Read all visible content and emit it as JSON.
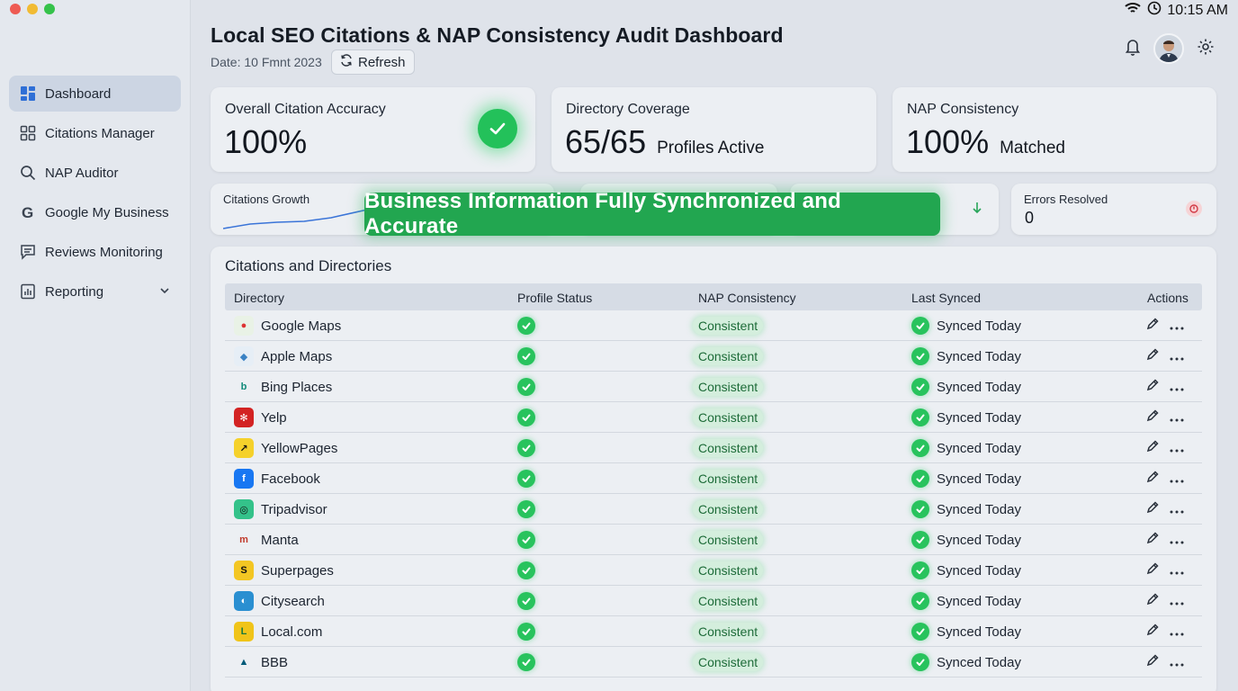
{
  "window": {
    "time": "10:15 AM"
  },
  "sidebar": {
    "items": [
      {
        "label": "Dashboard",
        "icon": "dashboard-icon",
        "active": true
      },
      {
        "label": "Citations Manager",
        "icon": "grid-icon"
      },
      {
        "label": "NAP Auditor",
        "icon": "search-icon"
      },
      {
        "label": "Google My Business",
        "icon": "google-icon"
      },
      {
        "label": "Reviews Monitoring",
        "icon": "chat-icon"
      },
      {
        "label": "Reporting",
        "icon": "report-icon",
        "expandable": true
      }
    ]
  },
  "header": {
    "title": "Local SEO Citations & NAP Consistency Audit Dashboard",
    "date": "Date: 10 Fmnt 2023",
    "refresh_label": "Refresh"
  },
  "kpis": [
    {
      "title": "Overall Citation Accuracy",
      "value": "100%",
      "sub": ""
    },
    {
      "title": "Directory Coverage",
      "value": "65/65",
      "sub": "Profiles Active"
    },
    {
      "title": "NAP Consistency",
      "value": "100%",
      "sub": "Matched"
    }
  ],
  "mini_cards": {
    "growth_title": "Citations Growth",
    "errors_title": "Errors Resolved",
    "errors_value": "0"
  },
  "banner": "Business Information Fully Synchronized and Accurate",
  "table": {
    "title": "Citations and Directories",
    "columns": [
      "Directory",
      "Profile Status",
      "NAP Consistency",
      "Last Synced",
      "Actions"
    ],
    "rows": [
      {
        "directory": "Google Maps",
        "nap": "Consistent",
        "synced": "Synced Today"
      },
      {
        "directory": "Apple Maps",
        "nap": "Consistent",
        "synced": "Synced Today"
      },
      {
        "directory": "Bing Places",
        "nap": "Consistent",
        "synced": "Synced Today"
      },
      {
        "directory": "Yelp",
        "nap": "Consistent",
        "synced": "Synced Today"
      },
      {
        "directory": "YellowPages",
        "nap": "Consistent",
        "synced": "Synced Today"
      },
      {
        "directory": "Facebook",
        "nap": "Consistent",
        "synced": "Synced Today"
      },
      {
        "directory": "Tripadvisor",
        "nap": "Consistent",
        "synced": "Synced Today"
      },
      {
        "directory": "Manta",
        "nap": "Consistent",
        "synced": "Synced Today"
      },
      {
        "directory": "Superpages",
        "nap": "Consistent",
        "synced": "Synced Today"
      },
      {
        "directory": "Citysearch",
        "nap": "Consistent",
        "synced": "Synced Today"
      },
      {
        "directory": "Local.com",
        "nap": "Consistent",
        "synced": "Synced Today"
      },
      {
        "directory": "BBB",
        "nap": "Consistent",
        "synced": "Synced Today"
      }
    ]
  },
  "colors": {
    "accent_green": "#22a650",
    "status_green": "#28c35d",
    "active_nav": "#ccd5e3",
    "nav_icon_blue": "#2f6fd6"
  }
}
